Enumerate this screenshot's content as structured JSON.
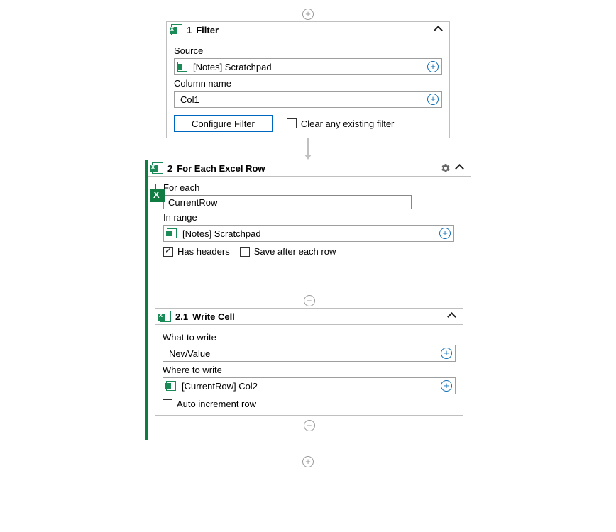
{
  "filter": {
    "step": "1",
    "title": "Filter",
    "source_label": "Source",
    "source_value": "[Notes] Scratchpad",
    "column_label": "Column name",
    "column_value": "Col1",
    "configure_btn": "Configure Filter",
    "clear_chk_label": "Clear any existing filter",
    "clear_chk_checked": false
  },
  "foreach": {
    "step": "2",
    "title": "For Each Excel Row",
    "for_each_label": "For each",
    "for_each_value": "CurrentRow",
    "in_range_label": "In range",
    "in_range_value": "[Notes] Scratchpad",
    "has_headers_label": "Has headers",
    "has_headers_checked": true,
    "save_label": "Save after each row",
    "save_checked": false
  },
  "writecell": {
    "step": "2.1",
    "title": "Write Cell",
    "what_label": "What to write",
    "what_value": "NewValue",
    "where_label": "Where to write",
    "where_value": "[CurrentRow] Col2",
    "auto_inc_label": "Auto increment row",
    "auto_inc_checked": false
  }
}
